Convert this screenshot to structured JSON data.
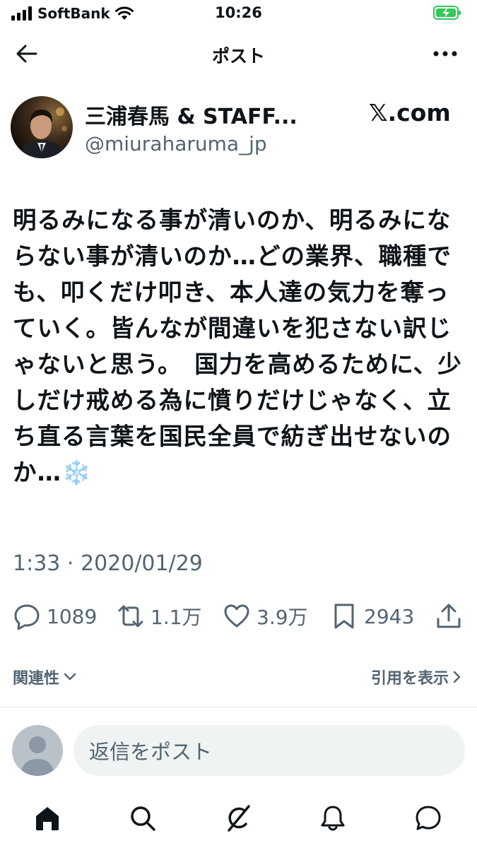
{
  "status_bar": {
    "carrier": "SoftBank",
    "time": "10:26",
    "battery": "charging"
  },
  "header": {
    "title": "ポスト"
  },
  "post": {
    "author_name": "三浦春馬 & STAFF...",
    "author_handle": "@miuraharuma_jp",
    "source_domain": "𝕏.com",
    "text": "明るみになる事が清いのか、明るみにならない事が清いのか…どの業界、職種でも、叩くだけ叩き、本人達の気力を奪っていく。皆んなが間違いを犯さない訳じゃないと思う。　国力を高めるために、少しだけ戒める為に憤りだけじゃなく、立ち直る言葉を国民全員で紡ぎ出せないのか…❄️",
    "timestamp": "1:33 · 2020/01/29"
  },
  "actions": {
    "replies": "1089",
    "reposts": "1.1万",
    "likes": "3.9万",
    "bookmarks": "2943"
  },
  "related": {
    "label": "関連性",
    "quotes_label": "引用を表示"
  },
  "reply": {
    "placeholder": "返信をポスト"
  },
  "icons": [
    "signal-icon",
    "wifi-icon",
    "battery-icon",
    "back-arrow-icon",
    "more-icon",
    "reply-icon",
    "repost-icon",
    "like-icon",
    "bookmark-icon",
    "share-icon",
    "chevron-down-icon",
    "chevron-right-icon",
    "home-icon",
    "search-icon",
    "grok-icon",
    "notifications-icon",
    "messages-icon"
  ],
  "colors": {
    "text": "#0f1419",
    "secondary": "#536471",
    "battery_green": "#34c759",
    "reply_box": "#eff3f4"
  }
}
